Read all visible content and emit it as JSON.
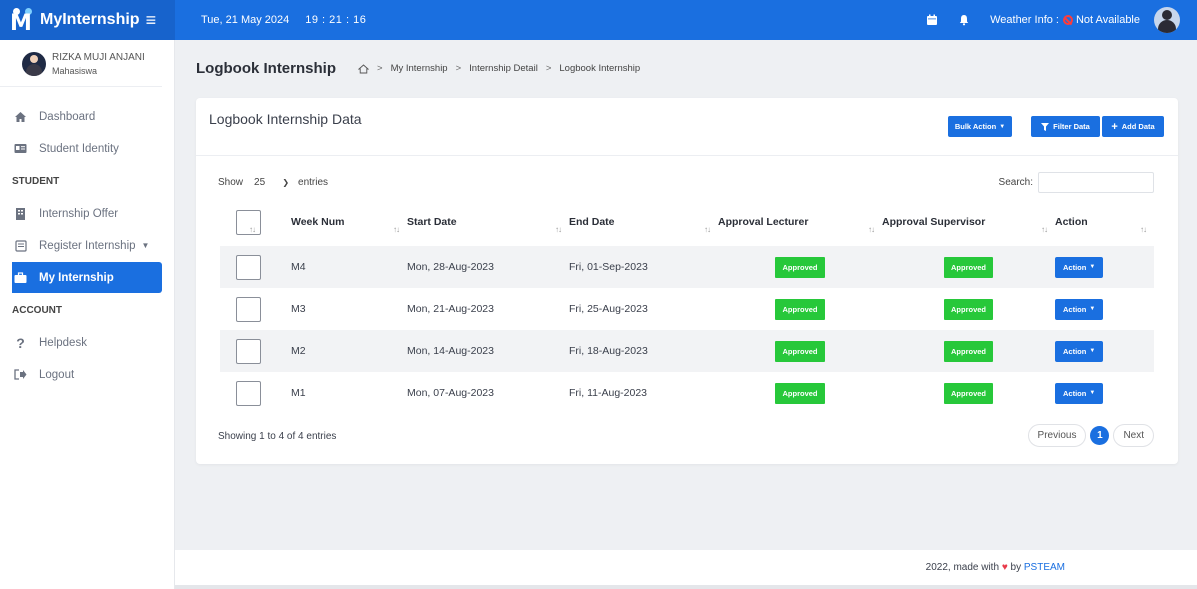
{
  "topbar": {
    "brand": "MyInternship",
    "date": "Tue, 21 May 2024",
    "time": "19 : 21 : 16",
    "weather_label": "Weather Info :",
    "weather_value": "Not Available"
  },
  "sidebar": {
    "user_name": "RIZKA MUJI ANJANI",
    "user_role": "Mahasiswa",
    "items": [
      {
        "label": "Dashboard",
        "icon": "home-icon"
      },
      {
        "label": "Student Identity",
        "icon": "id-card-icon"
      },
      {
        "label": "STUDENT",
        "type": "heading"
      },
      {
        "label": "Internship Offer",
        "icon": "building-icon"
      },
      {
        "label": "Register Internship",
        "icon": "form-icon"
      },
      {
        "label": "My Internship",
        "icon": "briefcase-icon",
        "active": true
      },
      {
        "label": "ACCOUNT",
        "type": "heading"
      },
      {
        "label": "Helpdesk",
        "icon": "question-icon"
      },
      {
        "label": "Logout",
        "icon": "logout-icon"
      }
    ]
  },
  "page": {
    "title": "Logbook Internship",
    "breadcrumb": [
      "My Internship",
      "Internship Detail",
      "Logbook Internship"
    ]
  },
  "card": {
    "title": "Logbook Internship Data",
    "bulk_action": "Bulk Action",
    "filter": "Filter Data",
    "add": "Add Data",
    "show_label": "Show",
    "entries_value": "25",
    "entries_label": "entries",
    "search_label": "Search:",
    "columns": [
      "Week Num",
      "Start Date",
      "End Date",
      "Approval Lecturer",
      "Approval Supervisor",
      "Action"
    ],
    "rows": [
      {
        "week": "M4",
        "start": "Mon, 28-Aug-2023",
        "end": "Fri, 01-Sep-2023",
        "lecturer": "Approved",
        "supervisor": "Approved",
        "action": "Action"
      },
      {
        "week": "M3",
        "start": "Mon, 21-Aug-2023",
        "end": "Fri, 25-Aug-2023",
        "lecturer": "Approved",
        "supervisor": "Approved",
        "action": "Action"
      },
      {
        "week": "M2",
        "start": "Mon, 14-Aug-2023",
        "end": "Fri, 18-Aug-2023",
        "lecturer": "Approved",
        "supervisor": "Approved",
        "action": "Action"
      },
      {
        "week": "M1",
        "start": "Mon, 07-Aug-2023",
        "end": "Fri, 11-Aug-2023",
        "lecturer": "Approved",
        "supervisor": "Approved",
        "action": "Action"
      }
    ],
    "showing": "Showing 1 to 4 of 4 entries",
    "prev": "Previous",
    "page": "1",
    "next": "Next"
  },
  "footer": {
    "prefix": "2022, made with",
    "by": "by",
    "link": "PSTEAM"
  },
  "colors": {
    "primary": "#1a6fe0",
    "approved": "#27c83a"
  }
}
